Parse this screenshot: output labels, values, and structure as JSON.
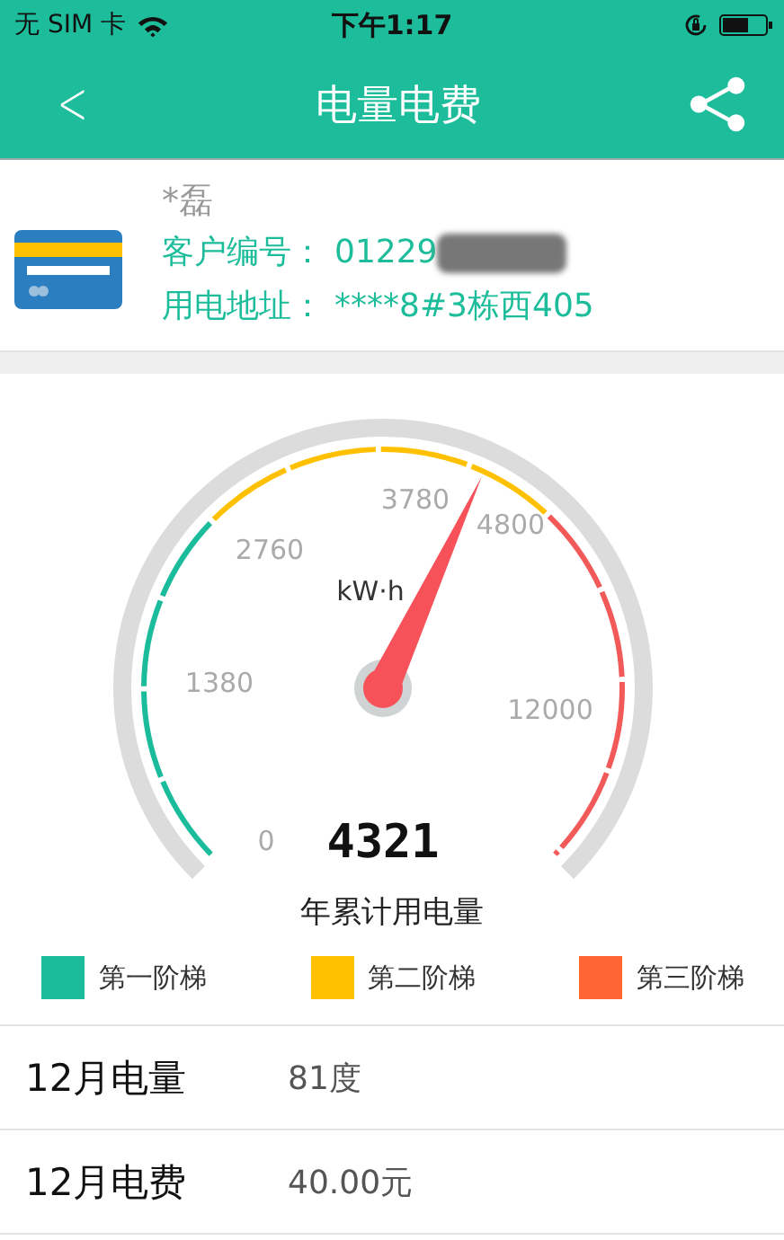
{
  "status_bar": {
    "carrier": "无 SIM 卡",
    "time": "下午1:17"
  },
  "nav": {
    "back": "<",
    "title": "电量电费"
  },
  "account": {
    "name": "*磊",
    "fields": [
      {
        "label": "客户编号：",
        "value": "01229",
        "redacted": true
      },
      {
        "label": "用电地址：",
        "value": "****8#3栋西405",
        "redacted": false
      }
    ]
  },
  "gauge": {
    "tick_labels": [
      "0",
      "1380",
      "2760",
      "3780",
      "4800",
      "12000"
    ],
    "unit": "kW·h",
    "reading": "4321",
    "caption": "年累计用电量"
  },
  "legend": [
    {
      "label": "第一阶梯",
      "color": "#1abc9c"
    },
    {
      "label": "第二阶梯",
      "color": "#ffc000"
    },
    {
      "label": "第三阶梯",
      "color": "#ff6633"
    }
  ],
  "rows": [
    {
      "label": "12月电量",
      "value": "81度"
    },
    {
      "label": "12月电费",
      "value": "40.00元"
    }
  ]
}
